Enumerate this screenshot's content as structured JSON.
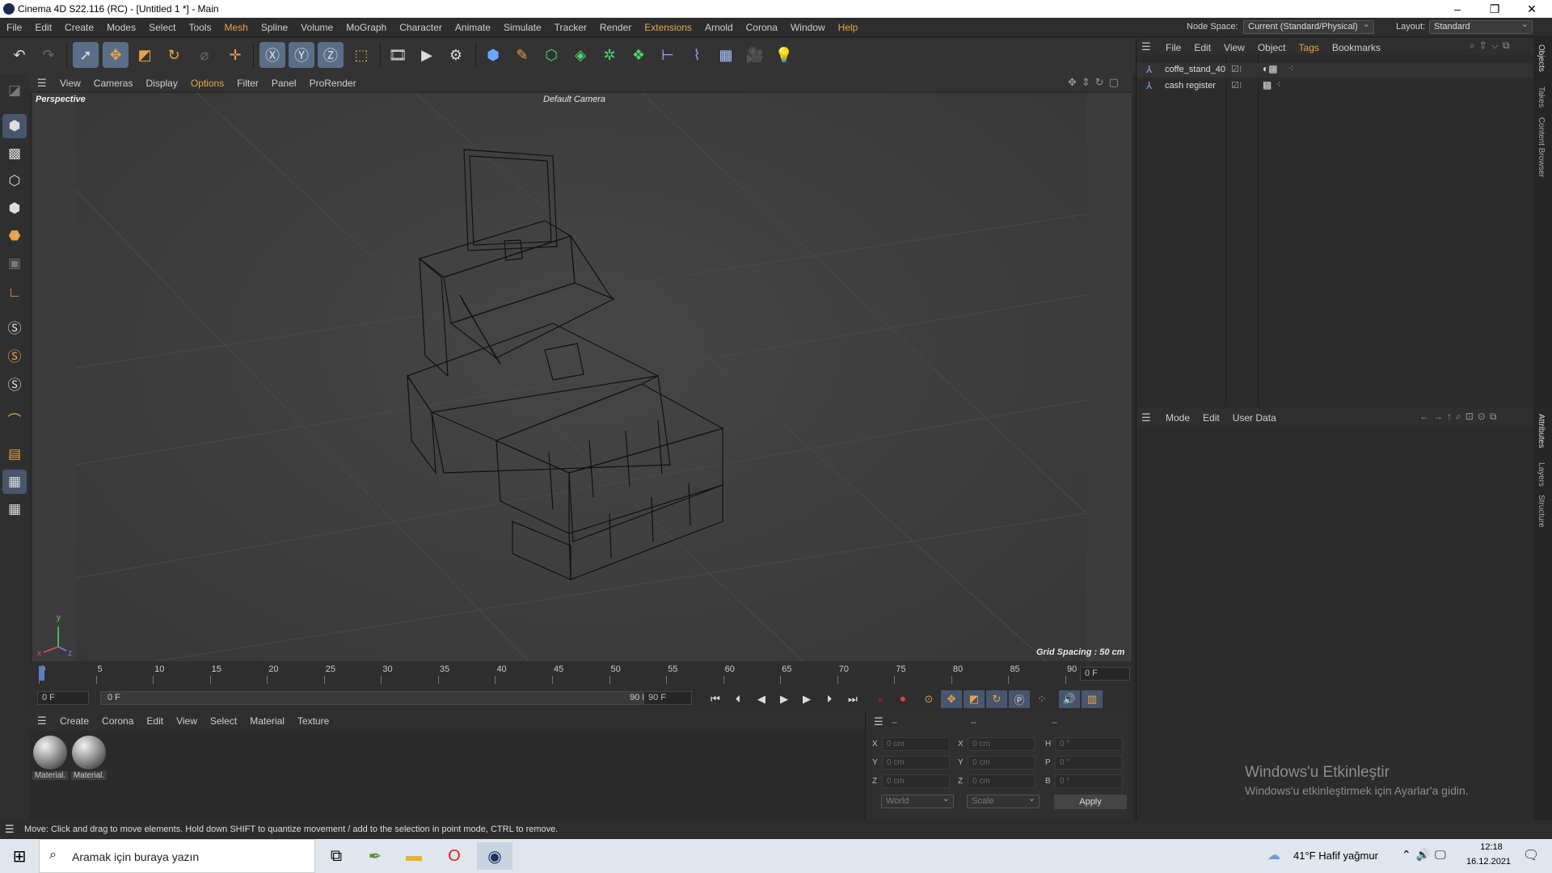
{
  "window": {
    "title": "Cinema 4D S22.116 (RC) - [Untitled 1 *] - Main",
    "min": "–",
    "restore": "❐",
    "close": "✕"
  },
  "menu": [
    "File",
    "Edit",
    "Create",
    "Modes",
    "Select",
    "Tools",
    "Mesh",
    "Spline",
    "Volume",
    "MoGraph",
    "Character",
    "Animate",
    "Simulate",
    "Tracker",
    "Render",
    "Extensions",
    "Arnold",
    "Corona",
    "Window",
    "Help"
  ],
  "menu_highlight": [
    "Mesh",
    "Extensions",
    "Help"
  ],
  "nodespace": {
    "label": "Node Space:",
    "value": "Current (Standard/Physical)"
  },
  "layout": {
    "label": "Layout:",
    "value": "Standard"
  },
  "toolbar_icons": [
    "undo-icon",
    "redo-icon",
    "select-icon",
    "move-icon",
    "scale-icon",
    "rotate-icon",
    "recent-tool-icon",
    "axis-icon",
    "x-lock-icon",
    "y-lock-icon",
    "z-lock-icon",
    "coordinate-system-icon",
    "render-region-icon",
    "render-view-icon",
    "render-settings-icon",
    "cube-icon",
    "pen-icon",
    "subdivision-icon",
    "extrude-icon",
    "cloner-icon",
    "mograph-icon",
    "symmetry-icon",
    "deformer-icon",
    "floor-icon",
    "camera-icon",
    "light-icon"
  ],
  "viewport": {
    "menu": [
      "View",
      "Cameras",
      "Display",
      "Options",
      "Filter",
      "Panel",
      "ProRender"
    ],
    "menu_highlight": "Options",
    "label": "Perspective",
    "camera": "Default Camera",
    "grid_spacing": "Grid Spacing : 50 cm",
    "axis": {
      "x": "x",
      "y": "y",
      "z": "z"
    }
  },
  "timeline": {
    "ticks": [
      "0",
      "5",
      "10",
      "15",
      "20",
      "25",
      "30",
      "35",
      "40",
      "45",
      "50",
      "55",
      "60",
      "65",
      "70",
      "75",
      "80",
      "85",
      "90"
    ],
    "current_frame": "0 F",
    "start": "0 F",
    "range_start": "0 F",
    "range_end": "90 F",
    "end": "90 F"
  },
  "materials": {
    "menu": [
      "Create",
      "Corona",
      "Edit",
      "View",
      "Select",
      "Material",
      "Texture"
    ],
    "items": [
      {
        "name": "Material."
      },
      {
        "name": "Material."
      }
    ]
  },
  "coordinates": {
    "headers": [
      "--",
      "--",
      "--"
    ],
    "rows": [
      {
        "a": "X",
        "av": "0 cm",
        "b": "X",
        "bv": "0 cm",
        "c": "H",
        "cv": "0 °"
      },
      {
        "a": "Y",
        "av": "0 cm",
        "b": "Y",
        "bv": "0 cm",
        "c": "P",
        "cv": "0 °"
      },
      {
        "a": "Z",
        "av": "0 cm",
        "b": "Z",
        "bv": "0 cm",
        "c": "B",
        "cv": "0 °"
      }
    ],
    "mode": "World",
    "scale": "Scale",
    "apply": "Apply"
  },
  "objects": {
    "menu": [
      "File",
      "Edit",
      "View",
      "Object",
      "Tags",
      "Bookmarks"
    ],
    "menu_highlight": "Tags",
    "items": [
      {
        "name": "coffe_stand_40"
      },
      {
        "name": "cash register"
      }
    ]
  },
  "attributes": {
    "menu": [
      "Mode",
      "Edit",
      "User Data"
    ]
  },
  "side_tabs": {
    "top": [
      "Objects",
      "Takes",
      "Content Browser"
    ],
    "bottom": [
      "Attributes",
      "Layers",
      "Structure"
    ]
  },
  "status": "Move: Click and drag to move elements. Hold down SHIFT to quantize movement / add to the selection in point mode, CTRL to remove.",
  "watermark": {
    "title": "Windows'u Etkinleştir",
    "subtitle": "Windows'u etkinleştirmek için Ayarlar'a gidin."
  },
  "taskbar": {
    "search_placeholder": "Aramak için buraya yazın",
    "weather": "41°F  Hafif yağmur",
    "time": "12:18",
    "date": "16.12.2021"
  }
}
